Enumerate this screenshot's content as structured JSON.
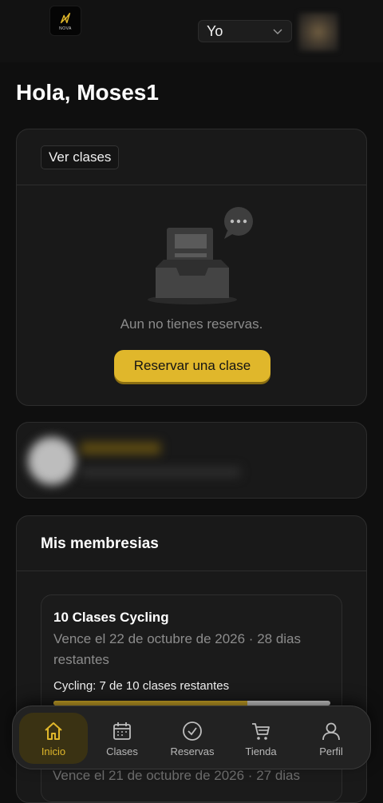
{
  "header": {
    "logo_text": "NOVA",
    "profile_select": {
      "selected": "Yo"
    }
  },
  "greeting": "Hola, Moses1",
  "reservas_card": {
    "tab_label": "Ver clases",
    "empty_message": "Aun no tienes reservas.",
    "cta_label": "Reservar una clase"
  },
  "memberships": {
    "title": "Mis membresias",
    "items": [
      {
        "name": "10 Clases Cycling",
        "expiry": "Vence el 22 de octubre de 2026 · 28 dias restantes",
        "remaining_text": "Cycling: 7 de 10 clases restantes",
        "progress_fraction": 0.7
      },
      {
        "expiry": "Vence el 21 de octubre de 2026 · 27 dias"
      }
    ]
  },
  "bottom_nav": {
    "items": [
      {
        "label": "Inicio",
        "icon": "home-icon",
        "active": true
      },
      {
        "label": "Clases",
        "icon": "calendar-icon",
        "active": false
      },
      {
        "label": "Reservas",
        "icon": "check-circle-icon",
        "active": false
      },
      {
        "label": "Tienda",
        "icon": "cart-icon",
        "active": false
      },
      {
        "label": "Perfil",
        "icon": "user-icon",
        "active": false
      }
    ]
  },
  "colors": {
    "accent": "#e0b72b",
    "background": "#0f0f0f",
    "card": "#191919"
  }
}
